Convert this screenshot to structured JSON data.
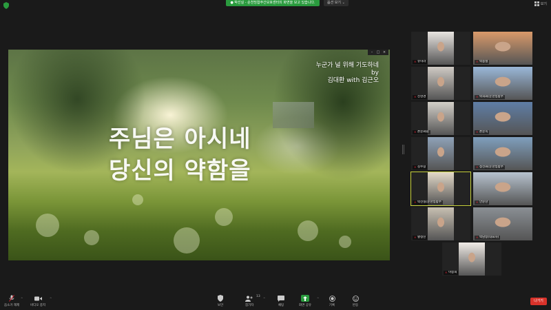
{
  "topbar": {
    "share_banner": "● 박선실 - 순천빙합주간보호센터의 화면을 보고 있습니다.",
    "view_options_label": "옵션 보기 ⌄",
    "view_label": "보기"
  },
  "slide": {
    "credit_line1": "누군가 널 위해 기도하네",
    "credit_line2": "by",
    "credit_line3": "김대환 with 김근오",
    "lyric_line1": "주님은 아시네",
    "lyric_line2": "당신의 약함을"
  },
  "participants": [
    {
      "name": "유미라",
      "bg": "#e8e4e0"
    },
    {
      "name": "박용철",
      "bg": "#d99a6a"
    },
    {
      "name": "신현경",
      "bg": "#cfcac4"
    },
    {
      "name": "박희화(순천빙합주",
      "bg": "#9ab7d8"
    },
    {
      "name": "손순화님",
      "bg": "#d3cfc8"
    },
    {
      "name": "손순옥",
      "bg": "#5f7ea6"
    },
    {
      "name": "김수길",
      "bg": "#8fa2b8"
    },
    {
      "name": "정선화(순천빙합주",
      "bg": "#7f9fbd"
    },
    {
      "name": "박선실(순천빙합주",
      "bg": "#e3d9c8"
    },
    {
      "name": "안문찬",
      "bg": "#b7c3cf"
    },
    {
      "name": "황정진",
      "bg": "#c8c0b2"
    },
    {
      "name": "박남승(대표자)",
      "bg": "#8a8f94"
    },
    {
      "name": "이승희",
      "bg": "#f0ebe6"
    }
  ],
  "toolbar": {
    "mute_label": "음소거 해제",
    "video_label": "비디오 중지",
    "security_label": "보안",
    "participants_label": "참가자",
    "participants_count": "13",
    "chat_label": "채팅",
    "share_label": "화면 공유",
    "record_label": "기록",
    "reactions_label": "반응",
    "leave_label": "나가기"
  },
  "colors": {
    "accent_green": "#2a9b3e",
    "leave_red": "#d9322a",
    "active_speaker": "#c8d23a"
  }
}
